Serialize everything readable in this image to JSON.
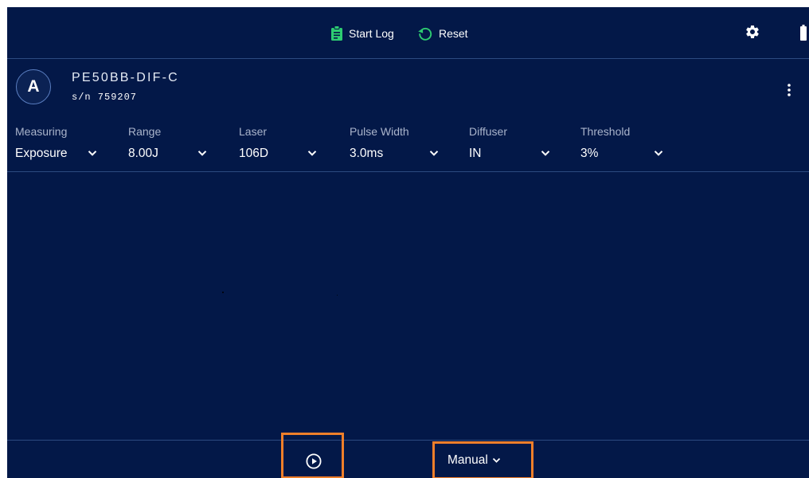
{
  "toolbar": {
    "start_log_label": "Start Log",
    "reset_label": "Reset",
    "accent_color": "#2ecc71",
    "icons": [
      "clipboard-icon",
      "reset-icon",
      "gear-icon",
      "battery-icon"
    ]
  },
  "device": {
    "channel": "A",
    "model": "PE50BB-DIF-C",
    "serial": "s/n 759207"
  },
  "settings": [
    {
      "label": "Measuring",
      "value": "Exposure"
    },
    {
      "label": "Range",
      "value": "8.00J"
    },
    {
      "label": "Laser",
      "value": "106D"
    },
    {
      "label": "Pulse Width",
      "value": "3.0ms"
    },
    {
      "label": "Diffuser",
      "value": "IN"
    },
    {
      "label": "Threshold",
      "value": "3%"
    }
  ],
  "bottom": {
    "mode_label": "Manual",
    "highlight_color": "#ef7f2a"
  }
}
